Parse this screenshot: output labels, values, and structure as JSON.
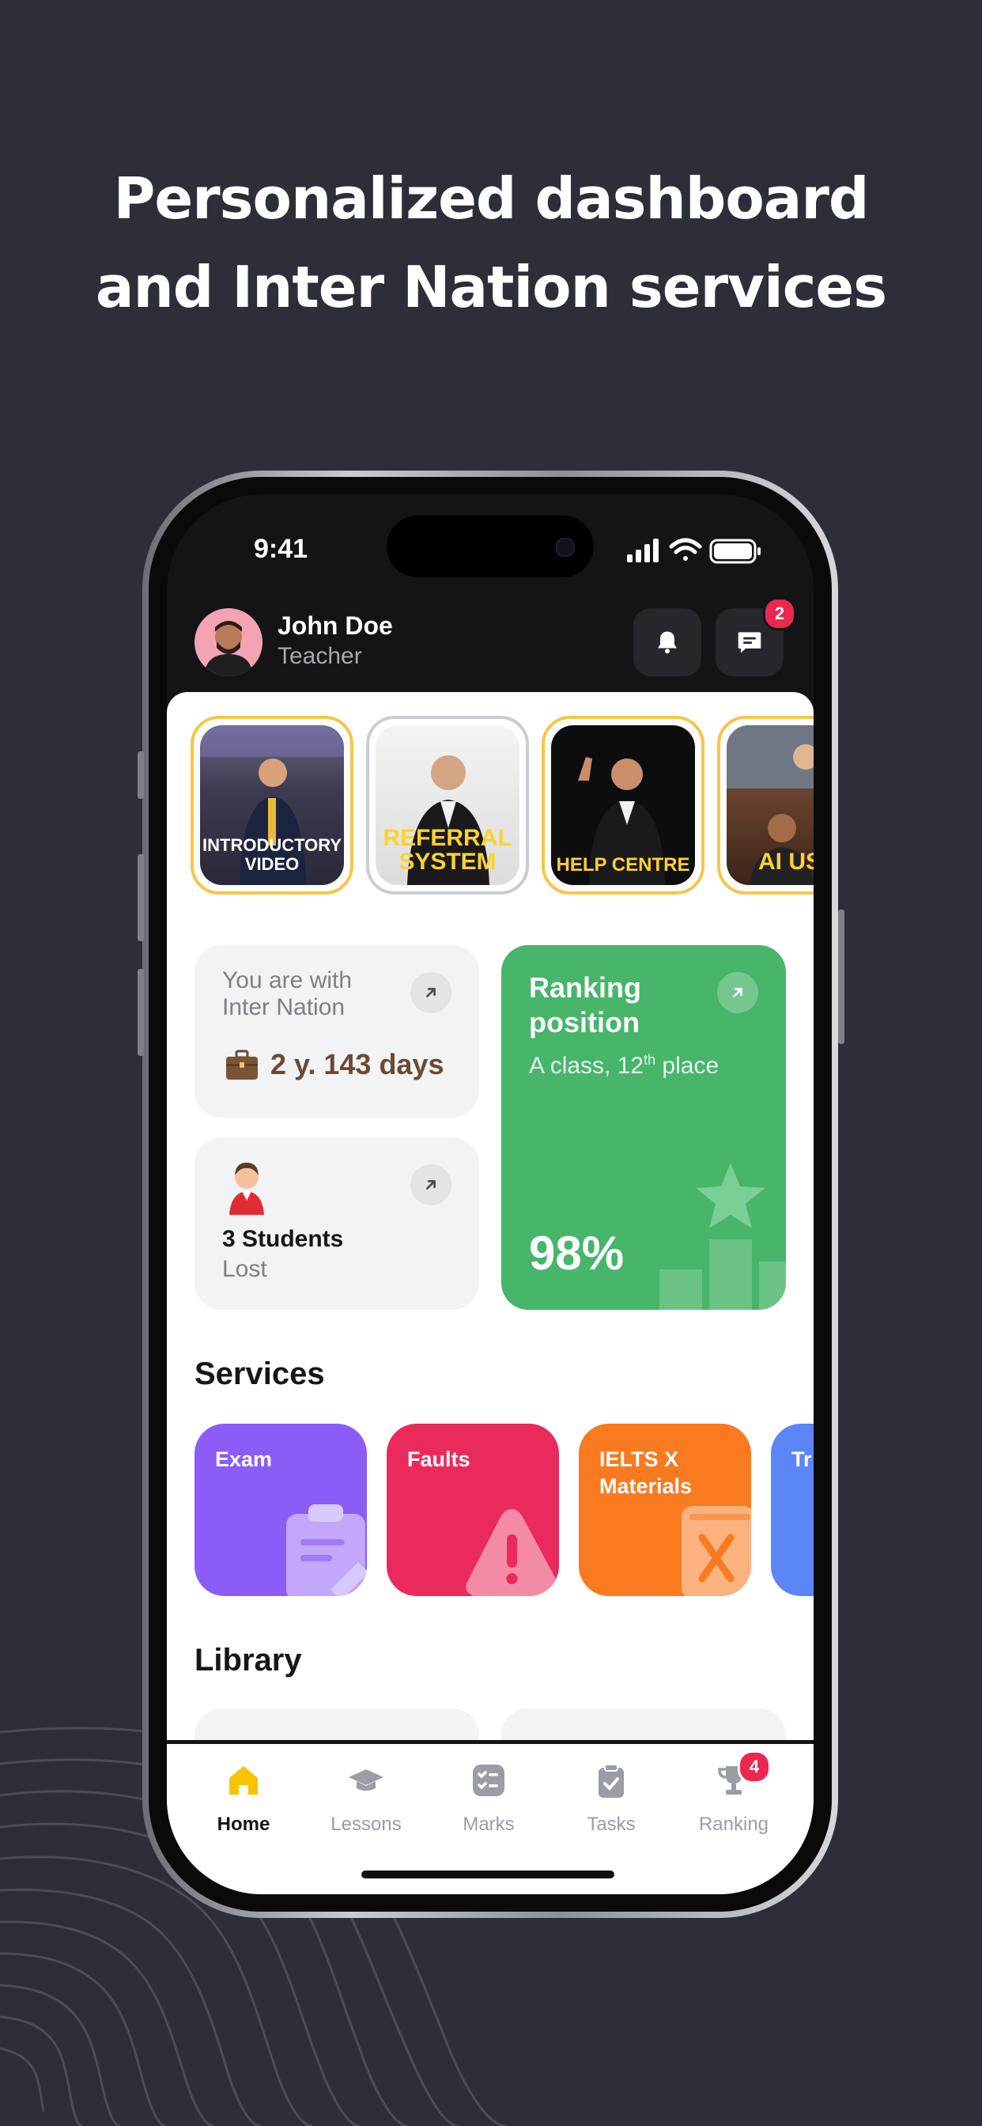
{
  "headline": {
    "line1": "Personalized dashboard",
    "line2": "and Inter Nation services"
  },
  "status_bar": {
    "time": "9:41"
  },
  "header": {
    "user_name": "John Doe",
    "user_role": "Teacher",
    "messages_badge": "2"
  },
  "stories": [
    {
      "label": "INTRODUCTORY VIDEO",
      "viewed": false
    },
    {
      "label": "REFERRAL SYSTEM",
      "viewed": true
    },
    {
      "label": "HELP CENTRE",
      "viewed": false
    },
    {
      "label": "AI UST",
      "viewed": false
    }
  ],
  "tenure_card": {
    "line1": "You are with",
    "line2": "Inter Nation",
    "value": "2 y. 143 days"
  },
  "students_card": {
    "title": "3 Students",
    "subtitle": "Lost"
  },
  "ranking_card": {
    "title_line1": "Ranking",
    "title_line2": "position",
    "subtitle_prefix": "A class, 12",
    "subtitle_sup": "th",
    "subtitle_suffix": " place",
    "percent": "98%"
  },
  "services": {
    "title": "Services",
    "items": [
      {
        "label": "Exam",
        "color": "#8b5cf6",
        "icon": "clipboard-icon"
      },
      {
        "label": "Faults",
        "color": "#ea2a5c",
        "icon": "warning-icon"
      },
      {
        "label": "IELTS X Materials",
        "label_line1": "IELTS X",
        "label_line2": "Materials",
        "color": "#f97a1f",
        "icon": "book-x-icon"
      },
      {
        "label": "Tr",
        "color": "#5b86f7",
        "icon": "partial"
      }
    ]
  },
  "library": {
    "title": "Library"
  },
  "tabbar": {
    "items": [
      {
        "label": "Home",
        "active": true,
        "icon": "home-icon"
      },
      {
        "label": "Lessons",
        "active": false,
        "icon": "graduation-cap-icon"
      },
      {
        "label": "Marks",
        "active": false,
        "icon": "checklist-icon"
      },
      {
        "label": "Tasks",
        "active": false,
        "icon": "clipboard-check-icon"
      },
      {
        "label": "Ranking",
        "active": false,
        "icon": "trophy-icon",
        "badge": "4"
      }
    ]
  },
  "colors": {
    "background": "#2c2f38",
    "accent_green": "#47b56a",
    "home_yellow": "#f8c300",
    "badge_red": "#ec2850"
  }
}
